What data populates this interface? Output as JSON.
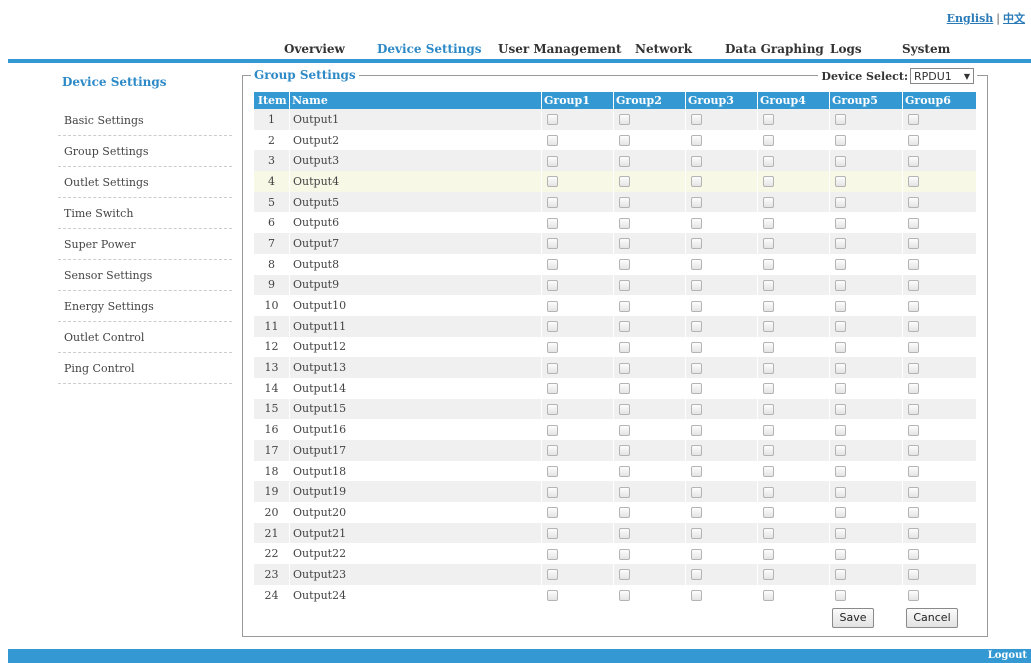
{
  "language": {
    "english": "English",
    "separator": "|",
    "chinese": "中文"
  },
  "nav": [
    {
      "label": "Overview"
    },
    {
      "label": "Device Settings"
    },
    {
      "label": "User Management"
    },
    {
      "label": "Network"
    },
    {
      "label": "Data Graphing"
    },
    {
      "label": "Logs"
    },
    {
      "label": "System"
    }
  ],
  "nav_active": "Device Settings",
  "sidebar": {
    "title": "Device Settings",
    "items": [
      {
        "label": "Basic Settings"
      },
      {
        "label": "Group Settings"
      },
      {
        "label": "Outlet Settings"
      },
      {
        "label": "Time Switch"
      },
      {
        "label": "Super Power"
      },
      {
        "label": "Sensor Settings"
      },
      {
        "label": "Energy Settings"
      },
      {
        "label": "Outlet Control"
      },
      {
        "label": "Ping Control"
      }
    ]
  },
  "group_settings": {
    "legend": "Group Settings",
    "device_select_label": "Device Select:",
    "device_select_value": "RPDU1",
    "columns": [
      "Item",
      "Name",
      "Group1",
      "Group2",
      "Group3",
      "Group4",
      "Group5",
      "Group6"
    ],
    "rows": [
      {
        "item": "1",
        "name": "Output1"
      },
      {
        "item": "2",
        "name": "Output2"
      },
      {
        "item": "3",
        "name": "Output3"
      },
      {
        "item": "4",
        "name": "Output4"
      },
      {
        "item": "5",
        "name": "Output5"
      },
      {
        "item": "6",
        "name": "Output6"
      },
      {
        "item": "7",
        "name": "Output7"
      },
      {
        "item": "8",
        "name": "Output8"
      },
      {
        "item": "9",
        "name": "Output9"
      },
      {
        "item": "10",
        "name": "Output10"
      },
      {
        "item": "11",
        "name": "Output11"
      },
      {
        "item": "12",
        "name": "Output12"
      },
      {
        "item": "13",
        "name": "Output13"
      },
      {
        "item": "14",
        "name": "Output14"
      },
      {
        "item": "15",
        "name": "Output15"
      },
      {
        "item": "16",
        "name": "Output16"
      },
      {
        "item": "17",
        "name": "Output17"
      },
      {
        "item": "18",
        "name": "Output18"
      },
      {
        "item": "19",
        "name": "Output19"
      },
      {
        "item": "20",
        "name": "Output20"
      },
      {
        "item": "21",
        "name": "Output21"
      },
      {
        "item": "22",
        "name": "Output22"
      },
      {
        "item": "23",
        "name": "Output23"
      },
      {
        "item": "24",
        "name": "Output24"
      }
    ],
    "save_label": "Save",
    "cancel_label": "Cancel"
  },
  "footer": {
    "logout": "Logout"
  },
  "colors": {
    "accent": "#3498d2",
    "active_text": "#2d8ac7",
    "highlight_row": "#f8f8e6"
  }
}
